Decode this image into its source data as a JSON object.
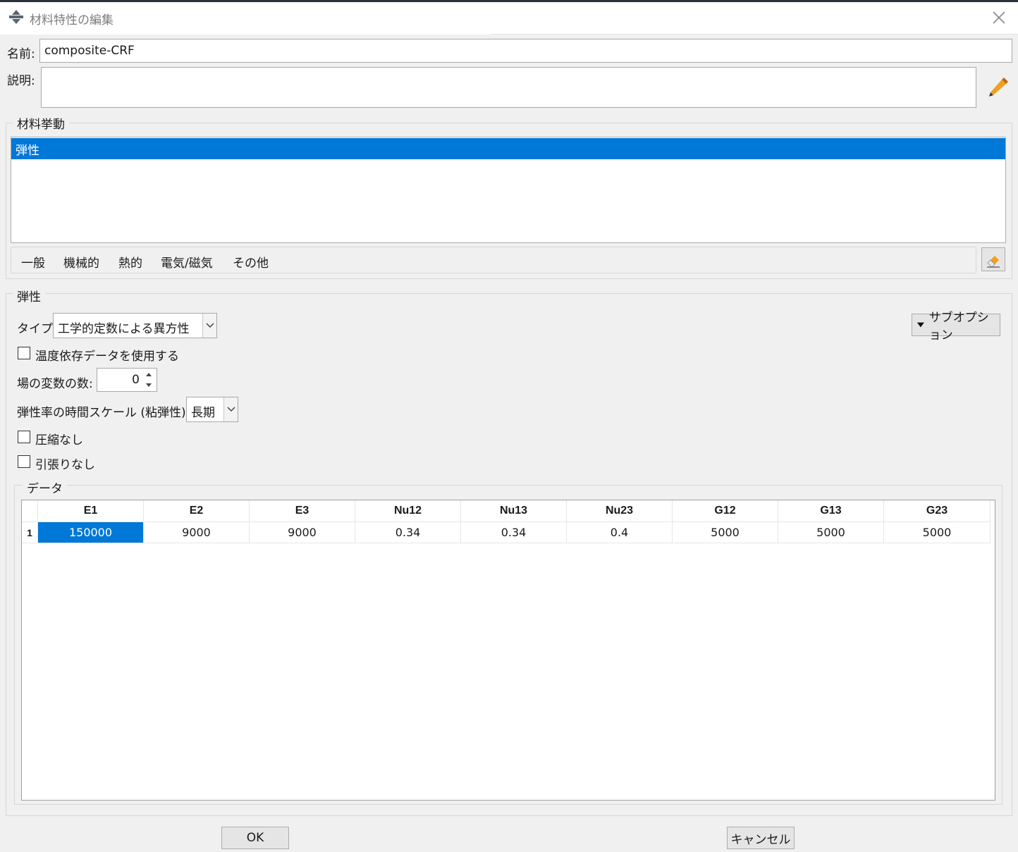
{
  "window": {
    "title": "材料特性の編集",
    "close_icon": "close-icon"
  },
  "name_label": "名前:",
  "name_value": "composite-CRF",
  "description_label": "説明:",
  "description_value": "",
  "behavior_group": {
    "title": "材料挙動",
    "items": [
      "弾性"
    ],
    "selected_index": 0
  },
  "menu": {
    "items": [
      "一般",
      "機械的",
      "熱的",
      "電気/磁気",
      "その他"
    ]
  },
  "elastic_group": {
    "title": "弾性",
    "type_label": "タイプ:",
    "type_value": "工学的定数による異方性",
    "suboptions_label": "サブオプション",
    "temp_dependent_label": "温度依存データを使用する",
    "temp_dependent_checked": false,
    "field_vars_label": "場の変数の数:",
    "field_vars_value": "0",
    "timescale_label": "弾性率の時間スケール (粘弾性):",
    "timescale_value": "長期",
    "no_compression_label": "圧縮なし",
    "no_compression_checked": false,
    "no_tension_label": "引張りなし",
    "no_tension_checked": false
  },
  "data_group": {
    "title": "データ",
    "columns": [
      "E1",
      "E2",
      "E3",
      "Nu12",
      "Nu13",
      "Nu23",
      "G12",
      "G13",
      "G23"
    ],
    "rows": [
      {
        "index": "1",
        "values": [
          "150000",
          "9000",
          "9000",
          "0.34",
          "0.34",
          "0.4",
          "5000",
          "5000",
          "5000"
        ]
      }
    ],
    "selected_cell": {
      "row": 0,
      "col": 0
    }
  },
  "buttons": {
    "ok": "OK",
    "cancel": "キャンセル"
  },
  "colors": {
    "selection": "#0078d7",
    "pencil": "#f0a020"
  }
}
